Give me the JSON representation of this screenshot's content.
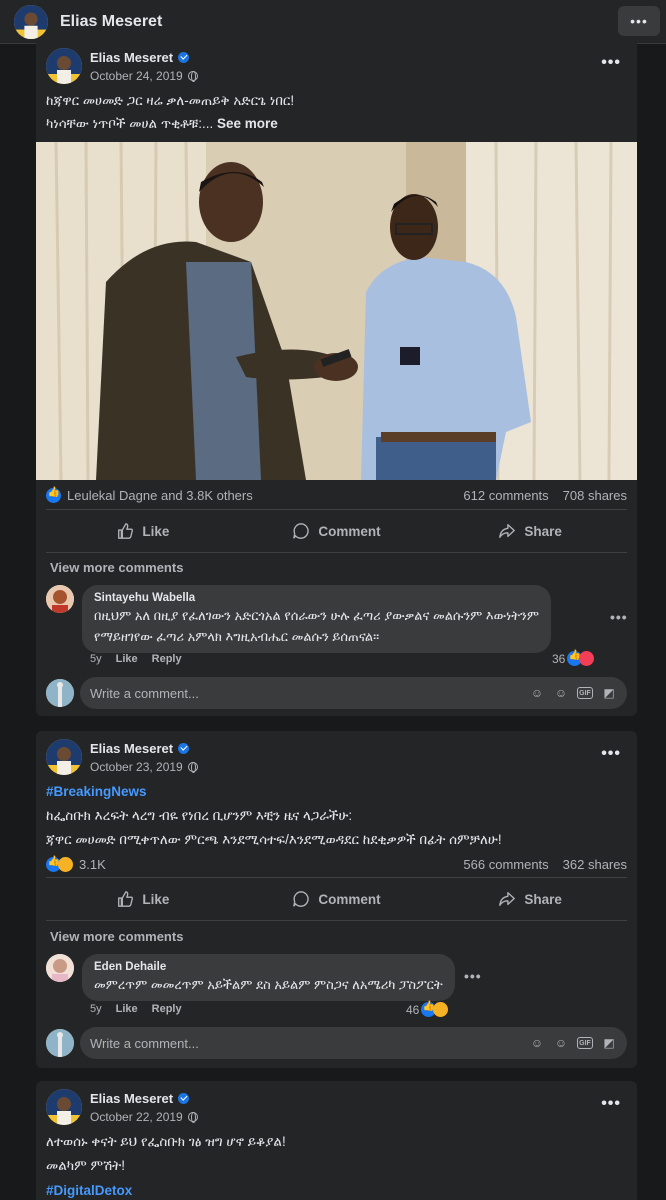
{
  "topbar": {
    "title": "Elias Meseret",
    "more_label": "•••"
  },
  "posts": [
    {
      "author": "Elias Meseret",
      "date": "October 24, 2019",
      "text_lines": [
        "ከጃዋር መሀመድ ጋር ዛሬ ቃለ-መጠይቅ አድርጌ ነበር!",
        "ካነሳቸው ነጥቦች መሀል ጥቂቶቹ:..."
      ],
      "see_more": "See more",
      "reactions_text": "Leulekal Dagne and 3.8K others",
      "comments_count": "612 comments",
      "shares_count": "708 shares",
      "actions": {
        "like": "Like",
        "comment": "Comment",
        "share": "Share"
      },
      "view_more_comments": "View more comments",
      "comment": {
        "author": "Sintayehu Wabella",
        "lines": [
          "በዚህም አለ በዚያ የፈለገውን አድርጎአል የሰራውን ሁሉ ፈጣሪ ያውቃልና መልሱንም እውነትንም",
          "የማይዘገየው ፈጣሪ አምላክ እግዚአብሔር መልሱን ይሰጠናል።"
        ],
        "age": "5y",
        "like": "Like",
        "reply": "Reply",
        "reaction_count": "36"
      },
      "write_placeholder": "Write a comment..."
    },
    {
      "author": "Elias Meseret",
      "date": "October 23, 2019",
      "hashtag": "#BreakingNews",
      "text_lines": [
        "ከፌስቡክ እረፍት ላረግ ብዬ የነበረ ቢሆንም እቺን ዜና ላጋራችሁ:",
        "ጃዋር መሀመድ በሚቀጥለው ምርጫ እንደሚሳተፍ/እንደሚወዳደር ከደቂቃዎች በፊት ሰምቻለሁ!"
      ],
      "reactions_text": "3.1K",
      "comments_count": "566 comments",
      "shares_count": "362 shares",
      "actions": {
        "like": "Like",
        "comment": "Comment",
        "share": "Share"
      },
      "view_more_comments": "View more comments",
      "comment": {
        "author": "Eden Dehaile",
        "lines": [
          "መምረጥም መመረጥም አይችልም ደስ አይልም ምስጋና ለአሜሪካ ፓስፖርት"
        ],
        "age": "5y",
        "like": "Like",
        "reply": "Reply",
        "reaction_count": "46"
      },
      "write_placeholder": "Write a comment..."
    },
    {
      "author": "Elias Meseret",
      "date": "October 22, 2019",
      "text_lines": [
        "ለተወሰኑ ቀናት ይህ የፌስቡክ ገፅ ዝግ ሆኖ ይቆያል!",
        "መልካም ምሽት!"
      ],
      "hashtag": "#DigitalDetox"
    }
  ],
  "colors": {
    "background": "#18191a",
    "card": "#242526",
    "accent": "#1877f2",
    "hashtag": "#4599ff",
    "secondary_text": "#b0b3b8"
  }
}
